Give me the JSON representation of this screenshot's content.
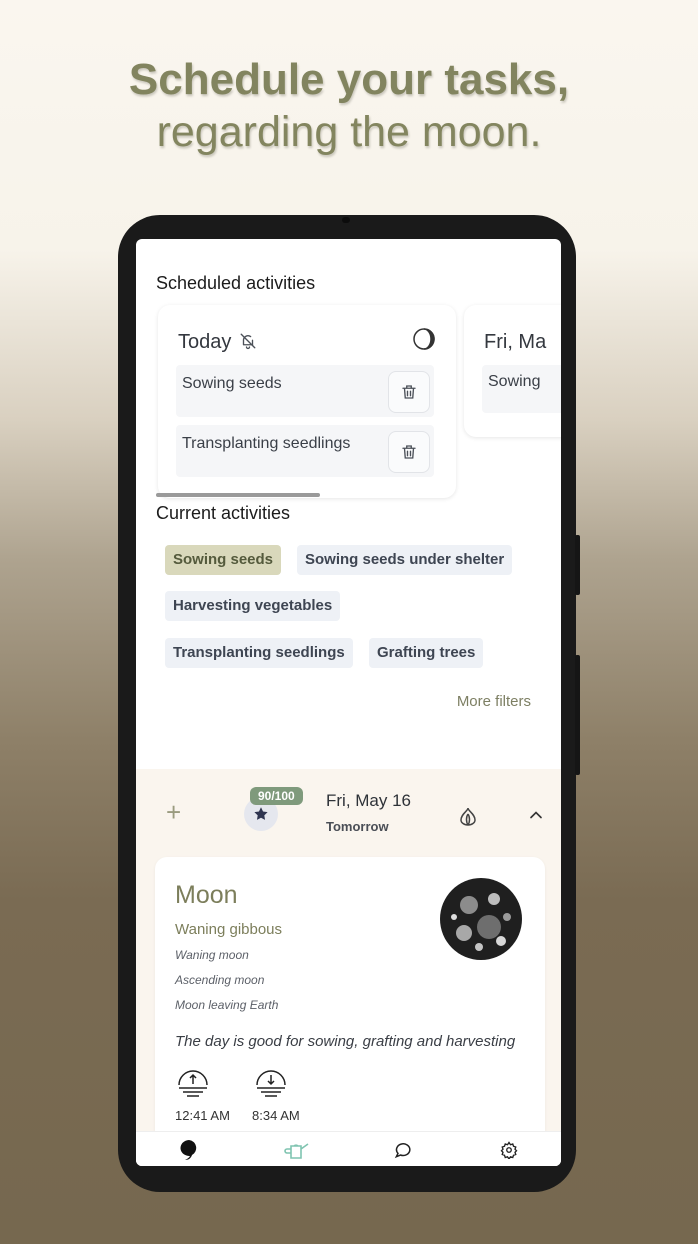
{
  "headline": {
    "line1": "Schedule your tasks,",
    "line2": "regarding the moon."
  },
  "scheduled": {
    "title": "Scheduled activities",
    "today": {
      "label": "Today",
      "tasks": [
        "Sowing seeds",
        "Transplanting seedlings"
      ]
    },
    "next": {
      "label": "Fri, Ma",
      "task": "Sowing"
    }
  },
  "current": {
    "title": "Current activities",
    "chips": [
      "Sowing seeds",
      "Sowing seeds under shelter",
      "Harvesting vegetables",
      "Transplanting seedlings",
      "Grafting trees"
    ],
    "active_chip": "Sowing seeds",
    "more_filters": "More filters"
  },
  "day": {
    "score": "90/100",
    "date": "Fri, May 16",
    "relative": "Tomorrow"
  },
  "moon": {
    "title": "Moon",
    "phase": "Waning gibbous",
    "details": [
      "Waning moon",
      "Ascending moon",
      "Moon leaving Earth"
    ],
    "advice": "The day is good for sowing, grafting and harvesting",
    "rise_time": "12:41 AM",
    "set_time": "8:34 AM"
  },
  "colors": {
    "accent": "#82845f",
    "chip_active": "#d9d8bb",
    "badge": "#7f9a7c"
  },
  "nav": {
    "items": [
      "moon-icon",
      "watering-can-icon",
      "chat-icon",
      "gear-icon"
    ]
  }
}
